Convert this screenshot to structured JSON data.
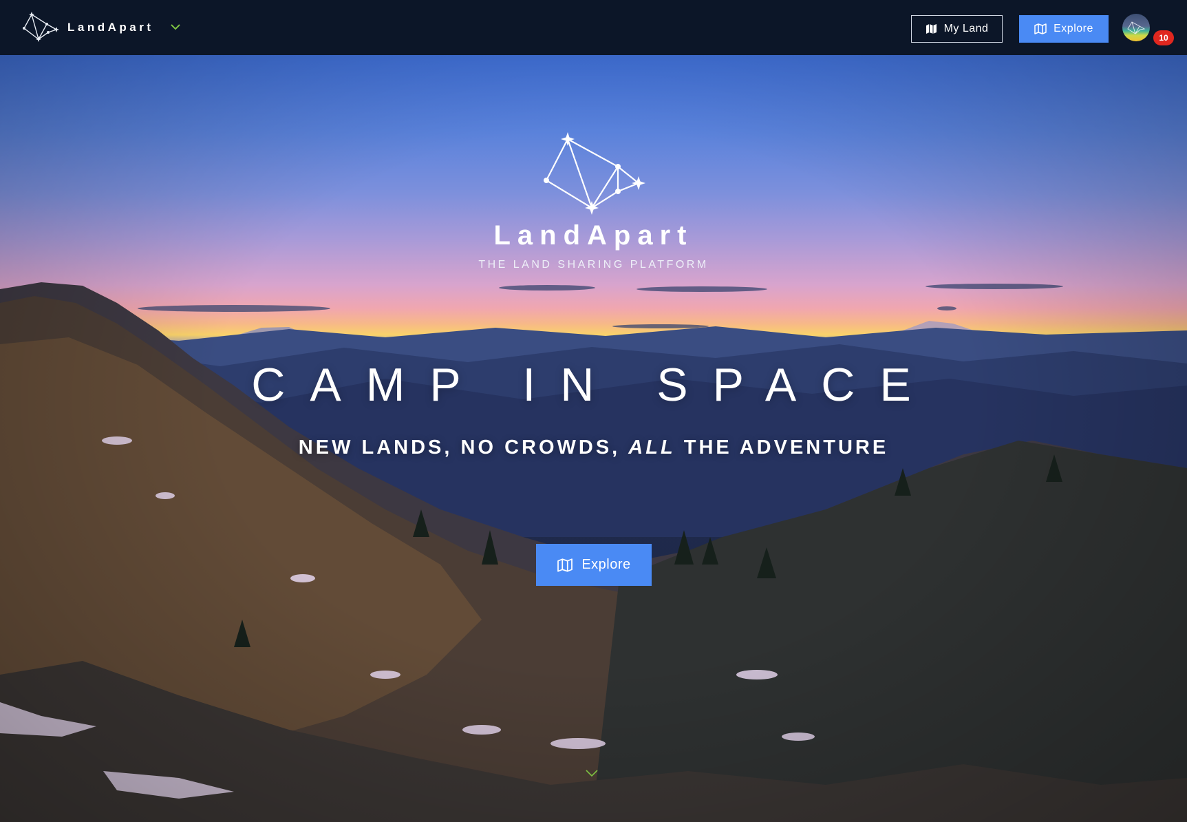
{
  "nav": {
    "brand_name": "LandApart",
    "my_land_label": "My Land",
    "explore_label": "Explore",
    "notification_count": "10"
  },
  "hero": {
    "brand_name": "LandApart",
    "tagline": "THE LAND SHARING PLATFORM",
    "headline": "CAMP IN SPACE",
    "sub_part1": "NEW LANDS, NO CROWDS,",
    "sub_emphasis": "ALL",
    "sub_part2": "THE ADVENTURE",
    "explore_label": "Explore"
  },
  "colors": {
    "nav_background": "#0c1628",
    "accent_blue": "#4a8af4",
    "badge_red": "#e0271f",
    "caret_green": "#7cc242"
  },
  "icons": {
    "brand": "constellation-logo-icon",
    "nav_caret": "chevron-down-icon",
    "my_land": "folded-map-icon",
    "explore": "map-outline-icon",
    "scroll": "chevron-down-icon"
  }
}
